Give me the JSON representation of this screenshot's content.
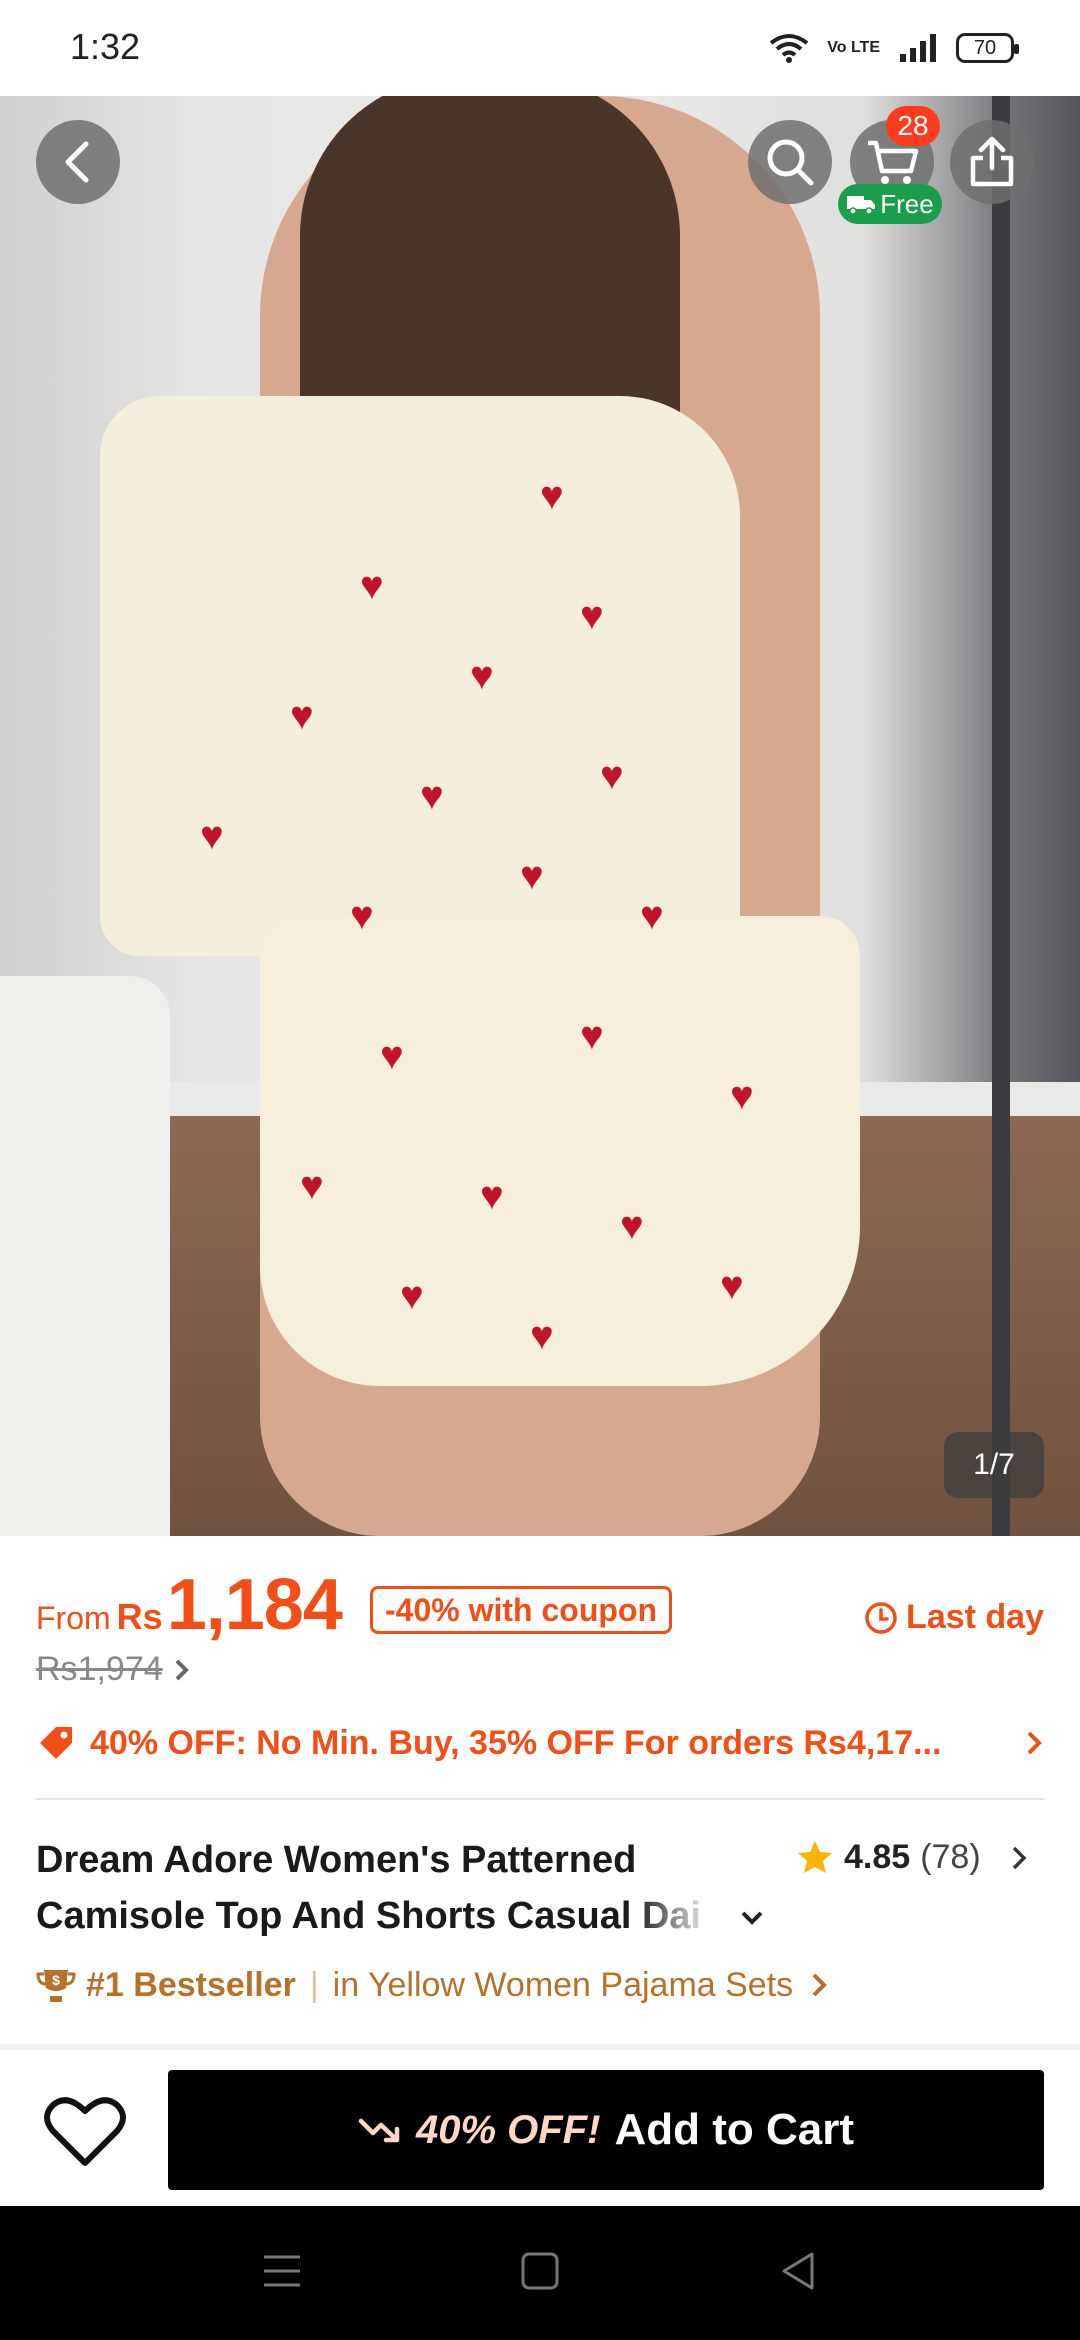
{
  "status_bar": {
    "time": "1:32",
    "network": "Vo LTE",
    "battery": "70"
  },
  "gallery": {
    "cart_count": "28",
    "free_shipping": "Free",
    "image_counter": "1/7"
  },
  "price": {
    "from": "From",
    "currency": "Rs",
    "amount": "1,184",
    "coupon": "-40% with coupon",
    "original": "Rs1,974",
    "deadline": "Last day",
    "promo": "40% OFF: No Min. Buy,  35% OFF For orders Rs4,17..."
  },
  "product": {
    "title_line1": "Dream Adore Women's Patterned",
    "title_line2": "Camisole Top And Shorts Casual Dai",
    "rating": "4.85",
    "review_count": "(78)",
    "bestseller_rank": "#1 Bestseller",
    "bestseller_category": "in Yellow Women Pajama Sets"
  },
  "actions": {
    "discount": "40% OFF!",
    "add_to_cart": "Add to Cart"
  },
  "colors": {
    "accent": "#f24e16",
    "bestseller": "#b6712a",
    "badge": "#ff3b1f",
    "free_pill": "#1a9e4b"
  },
  "icons": [
    "back-icon",
    "search-icon",
    "cart-icon",
    "share-icon",
    "truck-icon",
    "clock-icon",
    "tag-icon",
    "star-icon",
    "chevron-down-icon",
    "trophy-icon",
    "heart-icon",
    "trend-down-icon",
    "menu-icon",
    "home-square-icon",
    "back-triangle-icon"
  ]
}
